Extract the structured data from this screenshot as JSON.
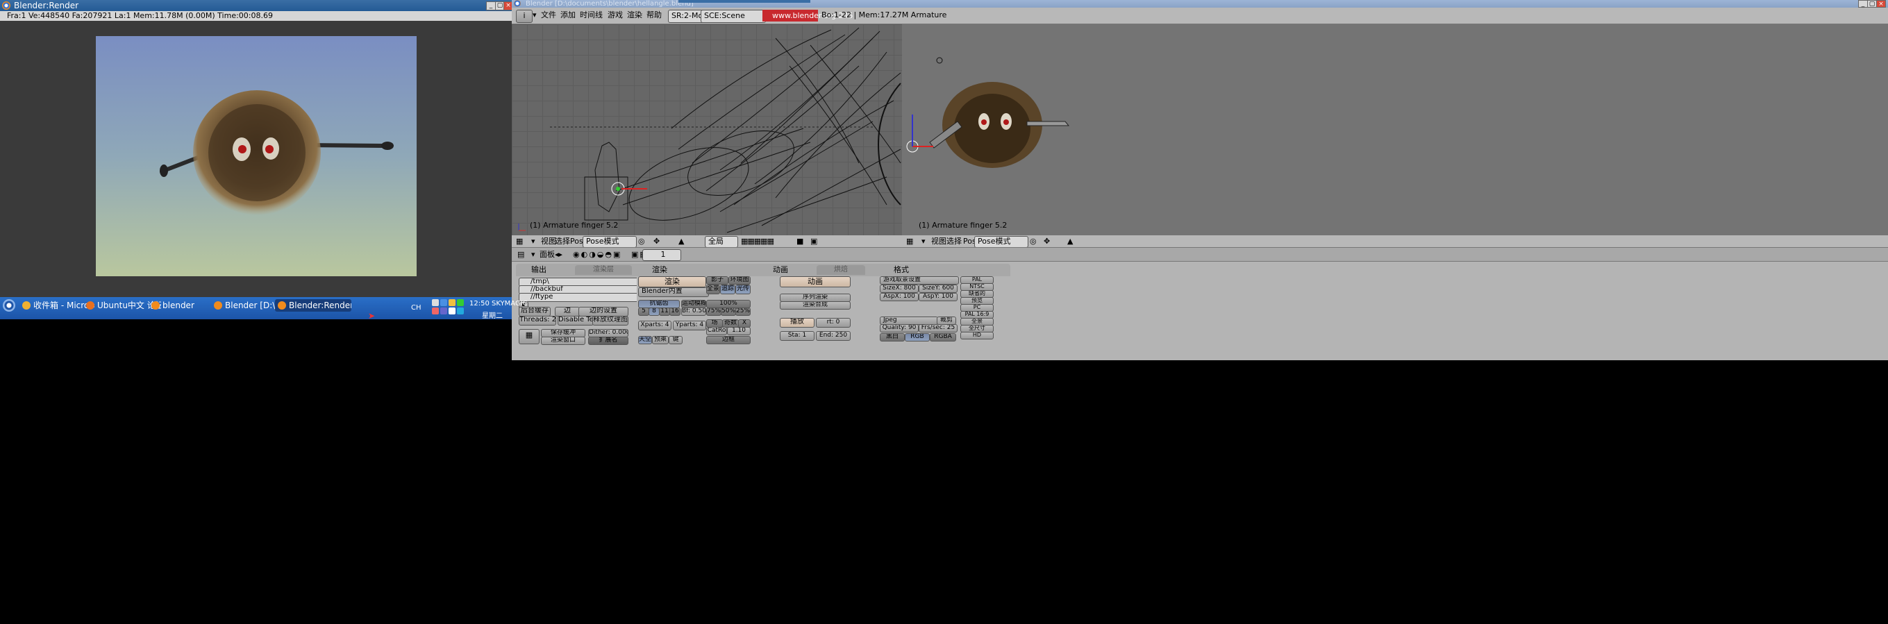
{
  "render_window": {
    "title": "Blender:Render",
    "stats": "Fra:1  Ve:448540 Fa:207921 La:1 Mem:11.78M (0.00M) Time:00:08.69"
  },
  "main_window": {
    "title": "Blender [D:\\documents\\blender\\hellangle.blend]",
    "menu": [
      "文件",
      "添加",
      "时间线",
      "游戏",
      "渲染",
      "帮助"
    ],
    "screen_field": "SR:2-Model",
    "scene_field": "SCE:Scene",
    "website": "www.blender.org 245",
    "info": "Bo:1-22  |  Mem:17.27M Armature"
  },
  "viewport_left": {
    "label": "(1) Armature finger 5.2",
    "menu": [
      "视图",
      "选择",
      "Pose"
    ],
    "mode": "Pose模式",
    "global": "全局"
  },
  "viewport_right": {
    "label": "(1) Armature finger 5.2",
    "menu": [
      "视图",
      "选择",
      "Pose"
    ],
    "mode": "Pose模式"
  },
  "buttons_header": {
    "panels_label": "面板",
    "frame": "1"
  },
  "output_panel": {
    "title": "输出",
    "tab": "渲染层",
    "paths": [
      "/tmp\\",
      "//backbuf",
      "//ftype"
    ],
    "backbuf_btn": "后台缓存",
    "edge_btn": "边",
    "edge_settings": "边的设置",
    "threads": "Threads: 2",
    "disable_tex": "Disable Tex",
    "free_tex": "释放纹理图像",
    "save_buffers": "保存缓冲",
    "dither": "Dither: 0.000",
    "render_window_select": "渲染窗口",
    "extensions": "扩展名"
  },
  "render_panel": {
    "title": "渲染",
    "render_btn": "渲染",
    "renderer": "Blender内置",
    "shadow": "影子",
    "envmap": "环境图",
    "pano": "全景",
    "raytrace": "追踪",
    "radio": "光传",
    "osa": "抗锯齿",
    "osa_levels": [
      "5",
      "8",
      "11",
      "16"
    ],
    "mblur": "运动模糊",
    "bf": "Bf: 0.50",
    "percent": "100%",
    "percents": [
      "75%",
      "50%",
      "25%"
    ],
    "xparts": "Xparts: 4",
    "yparts": "Yparts: 4",
    "fields": "场",
    "odd": "奇数",
    "x": "X",
    "catrom": "CatRo",
    "filter": "1.10",
    "sky": "天空",
    "premul": "预乘",
    "key": "键",
    "border": "边框"
  },
  "anim_panel": {
    "title": "动画",
    "tab": "烘焙",
    "anim_btn": "动画",
    "sequencer": "序列渲染",
    "compositor": "渲染合成",
    "play": "播放",
    "rt": "rt: 0",
    "start": "Sta: 1",
    "end": "End: 250"
  },
  "format_panel": {
    "title": "格式",
    "game_framing": "游戏取景设置",
    "sizex": "SizeX: 800",
    "sizey": "SizeY: 600",
    "aspx": "AspX: 100",
    "aspy": "AspY: 100",
    "format": "Jpeg",
    "crop": "裁剪",
    "quality": "Quality: 90",
    "fps": "Frs/sec: 25",
    "bw": "黑白",
    "rgb": "RGB",
    "rgba": "RGBA",
    "presets": [
      "PAL",
      "NTSC",
      "缺省的",
      "预览",
      "PC",
      "PAL 16:9",
      "全景",
      "全尺寸",
      "HD"
    ]
  },
  "taskbar": {
    "tasks": [
      "收件箱 - Microsoft ...",
      "Ubuntu中文 论坛 ::...",
      "blender",
      "Blender [D:\\docum...",
      "Blender:Render"
    ],
    "lang": "CH",
    "clock": "12:50 SKYMAGIC",
    "weekday": "星期二"
  },
  "colors": {
    "titlebar": "#245a95",
    "taskbar": "#1c54a8",
    "blender_bg": "#b4b4b4",
    "viewport": "#676767",
    "website_bg": "#c8292e"
  }
}
